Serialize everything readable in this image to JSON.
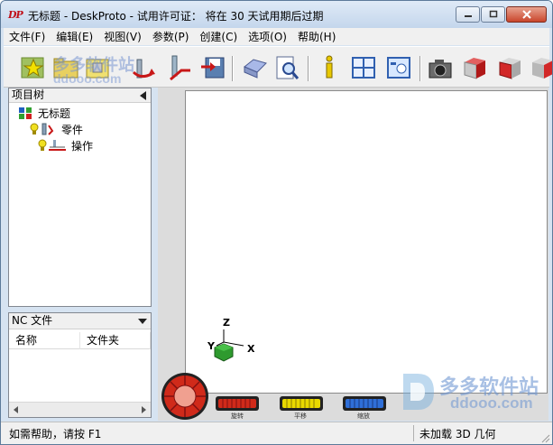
{
  "window": {
    "logo_text": "DP",
    "title": "无标题 - DeskProto - 试用许可证： 将在 30 天试用期后过期"
  },
  "menu": [
    "文件(F)",
    "编辑(E)",
    "视图(V)",
    "参数(P)",
    "创建(C)",
    "选项(O)",
    "帮助(H)"
  ],
  "toolbar": {
    "icons": [
      "new-project-icon",
      "open-icon",
      "open-part-icon",
      "import-icon",
      "toolpath-icon",
      "save-icon",
      "print-icon",
      "preview-icon",
      "info-icon",
      "layout-icon",
      "view-icon",
      "camera-icon",
      "cube-front-icon",
      "cube-side-icon",
      "cube-right-icon"
    ]
  },
  "watermark": {
    "top_cn": "多多软件站",
    "top_en": "ddooo.com",
    "br_cn": "多多软件站",
    "br_en": "ddooo.com"
  },
  "project_tree": {
    "header": "项目树",
    "items": [
      {
        "label": "无标题",
        "level": 0,
        "icon": "project-icon"
      },
      {
        "label": "零件",
        "level": 1,
        "icon": "part-icon"
      },
      {
        "label": "操作",
        "level": 2,
        "icon": "operation-icon"
      }
    ]
  },
  "nc_panel": {
    "header": "NC 文件",
    "columns": [
      "名称",
      "文件夹"
    ]
  },
  "viewport": {
    "axis_z": "Z",
    "axis_y": "Y",
    "axis_x": "X",
    "dials": [
      "旋转",
      "平移",
      "缩放"
    ]
  },
  "status": {
    "help": "如需帮助，请按 F1",
    "geometry": "未加载 3D 几何"
  },
  "colors": {
    "title_bar": "#c4d6ec",
    "close_button": "#c9462c",
    "viewport_bg": "#ffffff",
    "dial_red": "#d02a1a",
    "dial_yellow": "#e8d800",
    "dial_blue": "#2f6fd8"
  }
}
